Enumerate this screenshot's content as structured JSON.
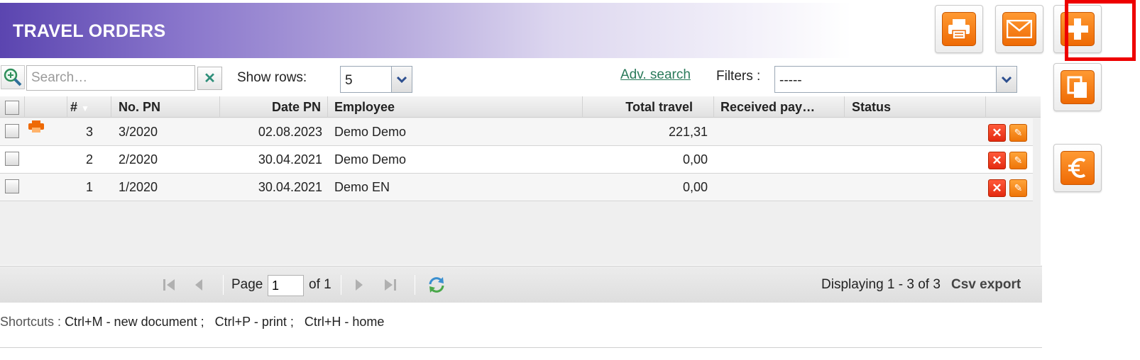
{
  "header": {
    "title": "TRAVEL ORDERS"
  },
  "actions": {
    "print": "printer-icon",
    "email": "envelope-icon",
    "add": "plus-icon",
    "copy": "copy-icon",
    "payment": "euro-icon"
  },
  "toolbar": {
    "search_placeholder": "Search…",
    "show_rows_label": "Show rows:",
    "rows_value": "5",
    "adv_search": "Adv. search",
    "filters_label": "Filters :",
    "filters_value": "-----"
  },
  "grid": {
    "columns": {
      "num": "#",
      "no_pn": "No. PN",
      "date_pn": "Date PN",
      "employee": "Employee",
      "total_travel": "Total travel",
      "received_pay": "Received pay…",
      "status": "Status"
    },
    "rows": [
      {
        "num": "3",
        "no_pn": "3/2020",
        "date_pn": "02.08.2023",
        "employee": "Demo Demo",
        "total_travel": "221,31",
        "received_pay": "",
        "status": "",
        "printed": true
      },
      {
        "num": "2",
        "no_pn": "2/2020",
        "date_pn": "30.04.2021",
        "employee": "Demo Demo",
        "total_travel": "0,00",
        "received_pay": "",
        "status": "",
        "printed": false
      },
      {
        "num": "1",
        "no_pn": "1/2020",
        "date_pn": "30.04.2021",
        "employee": "Demo EN",
        "total_travel": "0,00",
        "received_pay": "",
        "status": "",
        "printed": false
      }
    ]
  },
  "pager": {
    "page_label": "Page",
    "page_value": "1",
    "of_label": "of 1",
    "displaying": "Displaying 1 - 3 of 3",
    "csv_export": "Csv export"
  },
  "shortcuts": {
    "label": "Shortcuts :",
    "text": "Ctrl+M - new document ;   Ctrl+P - print ;   Ctrl+H - home"
  },
  "colors": {
    "accent": "#5b45b0",
    "orange": "#ee6a05",
    "highlight": "#ee0000",
    "link": "#2a7a5a"
  }
}
